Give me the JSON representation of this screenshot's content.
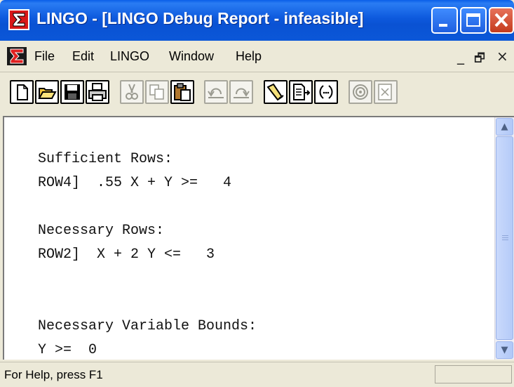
{
  "window": {
    "title": "LINGO - [LINGO Debug Report - infeasible]",
    "icon": "lingo-sigma-icon"
  },
  "menubar": {
    "items": [
      "File",
      "Edit",
      "LINGO",
      "Window",
      "Help"
    ],
    "mdi_controls": [
      "_",
      "🗗",
      "×"
    ]
  },
  "toolbar": {
    "buttons": [
      {
        "icon": "new-icon",
        "enabled": true
      },
      {
        "icon": "open-icon",
        "enabled": true
      },
      {
        "icon": "save-icon",
        "enabled": true
      },
      {
        "icon": "print-icon",
        "enabled": true
      },
      {
        "icon": "cut-icon",
        "enabled": false
      },
      {
        "icon": "copy-icon",
        "enabled": false
      },
      {
        "icon": "paste-icon",
        "enabled": true
      },
      {
        "icon": "undo-icon",
        "enabled": false
      },
      {
        "icon": "redo-icon",
        "enabled": false
      },
      {
        "icon": "find-icon",
        "enabled": true
      },
      {
        "icon": "goto-line-icon",
        "enabled": true
      },
      {
        "icon": "match-parenthesis-icon",
        "enabled": true
      },
      {
        "icon": "solve-icon",
        "enabled": false
      },
      {
        "icon": "solution-icon",
        "enabled": false
      }
    ]
  },
  "report": {
    "lines": [
      "Sufficient Rows:",
      "ROW4]  .55 X + Y >=   4",
      "",
      "Necessary Rows:",
      "ROW2]  X + 2 Y <=   3",
      "",
      "",
      "Necessary Variable Bounds:",
      "Y >=  0"
    ]
  },
  "statusbar": {
    "text": "For Help, press F1"
  },
  "colors": {
    "titlebar": "#0a52d3",
    "close_button": "#c53b1d",
    "workspace": "#ece9d8"
  }
}
